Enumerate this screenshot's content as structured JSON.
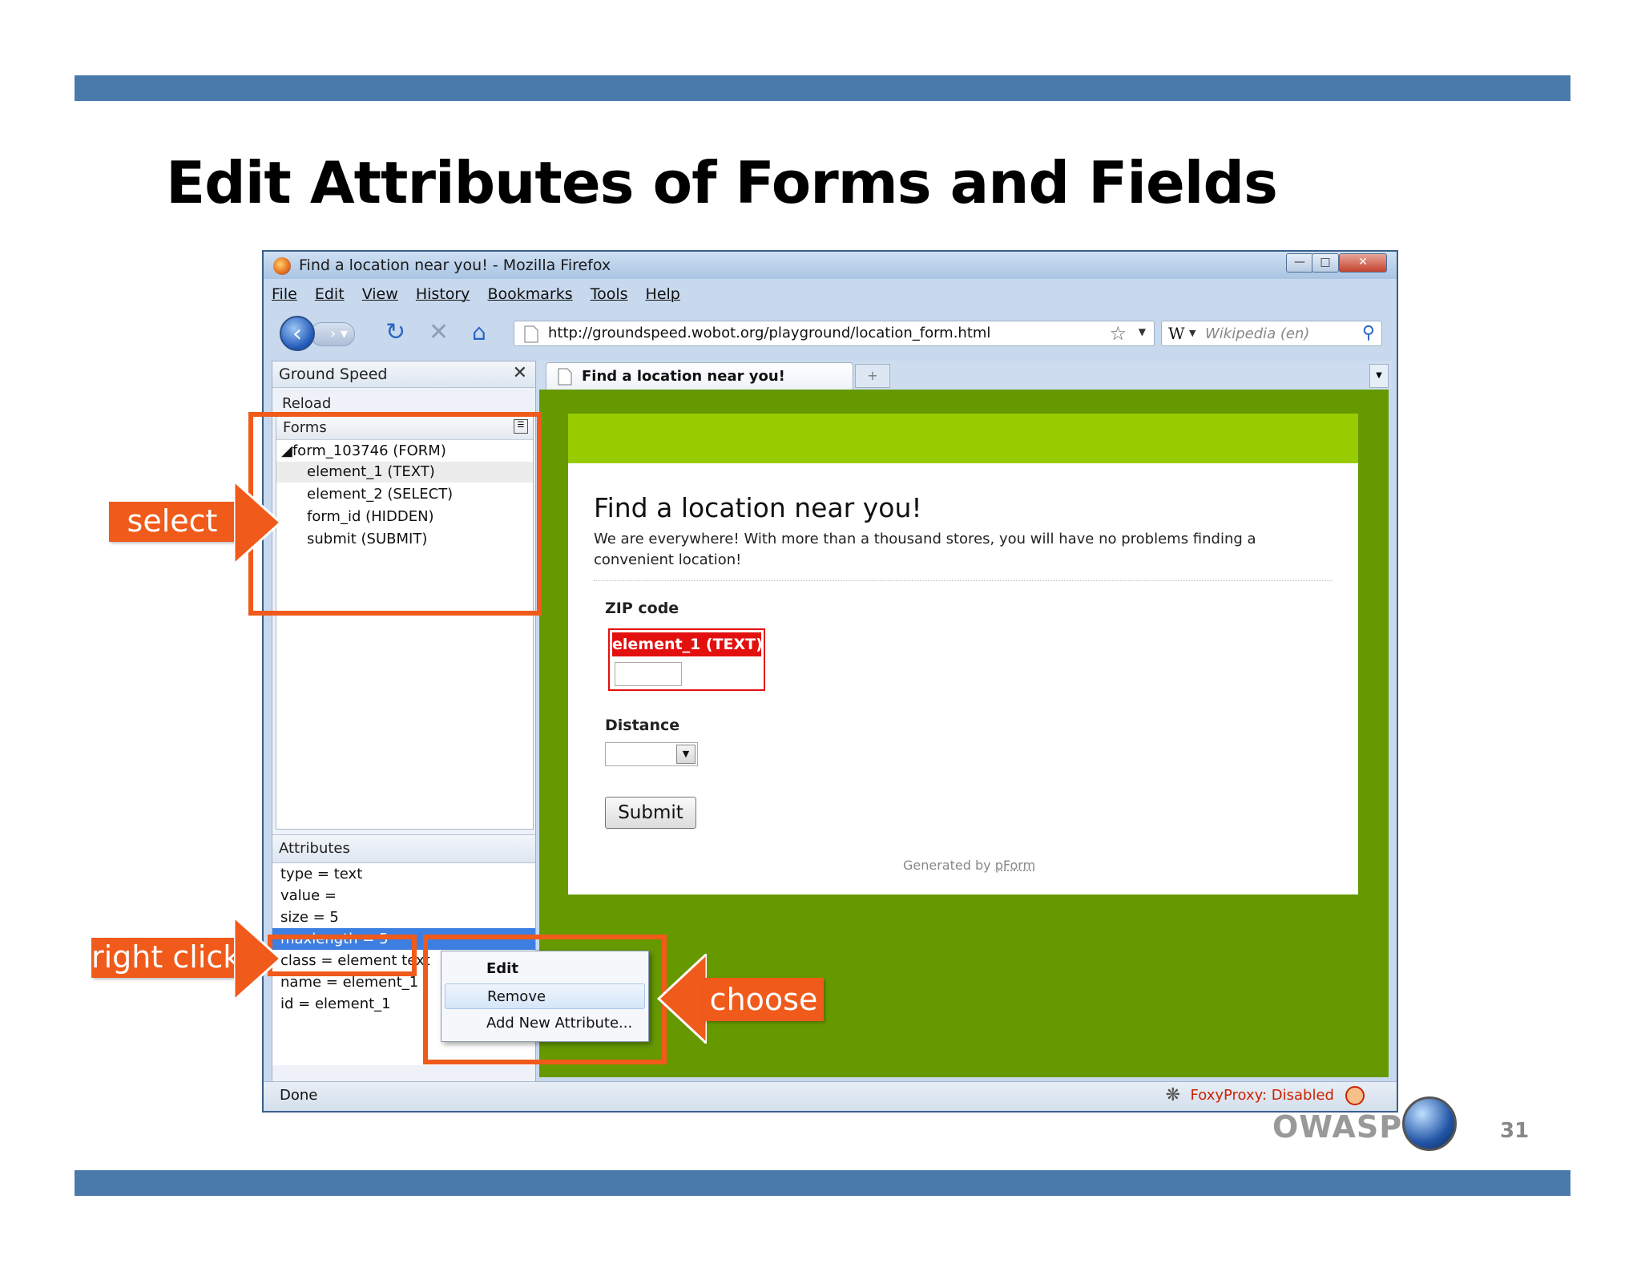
{
  "slide": {
    "title": "Edit Attributes of Forms and Fields",
    "page_number": "31",
    "logo_text": "OWASP",
    "band_color": "#4a7aab"
  },
  "browser": {
    "window_title": "Find a location near you! - Mozilla Firefox",
    "menu": [
      "File",
      "Edit",
      "View",
      "History",
      "Bookmarks",
      "Tools",
      "Help"
    ],
    "url": "http://groundspeed.wobot.org/playground/location_form.html",
    "search_placeholder": "Wikipedia (en)",
    "search_engine_glyph": "W",
    "tab_label": "Find a location near you!",
    "status": "Done",
    "foxyproxy_status": "FoxyProxy: Disabled"
  },
  "sidebar": {
    "title": "Ground Speed",
    "reload_label": "Reload",
    "forms_label": "Forms",
    "tree": [
      "◢form_103746 (FORM)",
      "element_1 (TEXT)",
      "element_2 (SELECT)",
      "form_id (HIDDEN)",
      "submit (SUBMIT)"
    ],
    "attributes_label": "Attributes",
    "attributes": [
      "type = text",
      "value =",
      "size = 5",
      "maxlength = 5",
      "class = element text",
      "name = element_1",
      "id = element_1"
    ]
  },
  "page": {
    "heading": "Find a location near you!",
    "description": "We are everywhere! With more than a thousand stores, you will have no problems finding a convenient location!",
    "zip_label": "ZIP code",
    "zip_badge": "element_1 (TEXT)",
    "distance_label": "Distance",
    "submit_label": "Submit",
    "generated_prefix": "Generated by",
    "generated_link": "pForm"
  },
  "context_menu": [
    "Edit",
    "Remove",
    "Add New Attribute..."
  ],
  "annotations": {
    "select": "select",
    "right_click": "right click",
    "choose": "choose",
    "color": "#f05a1a"
  }
}
